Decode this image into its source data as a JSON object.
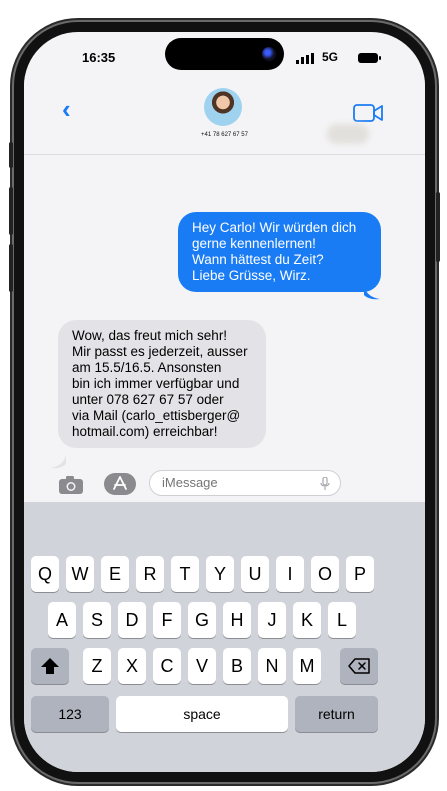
{
  "status": {
    "time": "16:35",
    "network": "5G"
  },
  "header": {
    "contact_number": "+41 78 627 67 57"
  },
  "messages": [
    {
      "direction": "sent",
      "text": "Hey Carlo! Wir würden dich\ngerne kennenlernen!\nWann hättest du Zeit?\nLiebe Grüsse, Wirz."
    },
    {
      "direction": "received",
      "text": "Wow, das freut mich sehr!\nMir passt es jederzeit, ausser\nam 15.5/16.5. Ansonsten\nbin ich immer verfügbar und\nunter 078 627 67 57 oder\nvia Mail (carlo_ettisberger@\nhotmail.com) erreichbar!"
    }
  ],
  "composer": {
    "placeholder": "iMessage"
  },
  "keyboard": {
    "row1": [
      "Q",
      "W",
      "E",
      "R",
      "T",
      "Y",
      "U",
      "I",
      "O",
      "P"
    ],
    "row2": [
      "A",
      "S",
      "D",
      "F",
      "G",
      "H",
      "J",
      "K",
      "L"
    ],
    "row3": [
      "Z",
      "X",
      "C",
      "V",
      "B",
      "N",
      "M"
    ],
    "numbers_label": "123",
    "space_label": "space",
    "return_label": "return"
  },
  "colors": {
    "accent": "#1a7cf5",
    "received_bubble": "#e3e3e7",
    "keyboard_bg": "#d0d3d9"
  }
}
